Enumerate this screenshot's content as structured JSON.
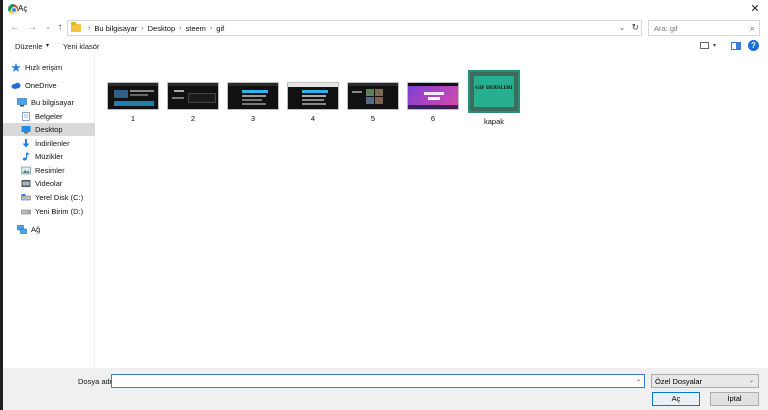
{
  "window": {
    "title": "Aç",
    "close_glyph": "✕"
  },
  "nav": {
    "back_glyph": "←",
    "forward_glyph": "→",
    "recent_glyph": "⌄",
    "up_glyph": "↑",
    "breadcrumb": [
      "Bu bilgisayar",
      "Desktop",
      "steem",
      "gif"
    ],
    "separator": "›",
    "dropdown_glyph": "⌄",
    "refresh_glyph": "↻",
    "search_placeholder": "Ara: gif",
    "search_glyph": "⌕"
  },
  "toolbar": {
    "organize_label": "Düzenle",
    "organize_dd": "▾",
    "new_folder_label": "Yeni klasör",
    "view_dd": "▾",
    "help_glyph": "?"
  },
  "sidebar": {
    "items": [
      {
        "label": "Hızlı erişim",
        "icon": "star-icon"
      },
      {
        "label": "OneDrive",
        "icon": "cloud-icon"
      },
      {
        "label": "Bu bilgisayar",
        "icon": "computer-icon"
      },
      {
        "label": "Belgeler",
        "icon": "documents-icon"
      },
      {
        "label": "Desktop",
        "icon": "desktop-icon",
        "selected": true
      },
      {
        "label": "İndirilenler",
        "icon": "download-icon"
      },
      {
        "label": "Müzikler",
        "icon": "music-icon"
      },
      {
        "label": "Resimler",
        "icon": "pictures-icon"
      },
      {
        "label": "Videolar",
        "icon": "videos-icon"
      },
      {
        "label": "Yerel Disk (C:)",
        "icon": "drive-c-icon"
      },
      {
        "label": "Yeni Birim (D:)",
        "icon": "drive-d-icon"
      },
      {
        "label": "Ağ",
        "icon": "network-icon"
      }
    ]
  },
  "files": [
    {
      "name": "1"
    },
    {
      "name": "2"
    },
    {
      "name": "3"
    },
    {
      "name": "4"
    },
    {
      "name": "5"
    },
    {
      "name": "6"
    },
    {
      "name": "kapak",
      "thumb_text": "GIF DERSLERİ"
    }
  ],
  "bottom": {
    "filename_label": "Dosya adı:",
    "filename_value": "",
    "filename_dd": "⌄",
    "filter_value": "Özel Dosyalar",
    "filter_dd": "⌄",
    "open_label": "Aç",
    "cancel_label": "İptal"
  },
  "colors": {
    "accent": "#0078d7",
    "selected_bg": "#d9d9d9",
    "footer_bg": "#f0f0f0"
  }
}
